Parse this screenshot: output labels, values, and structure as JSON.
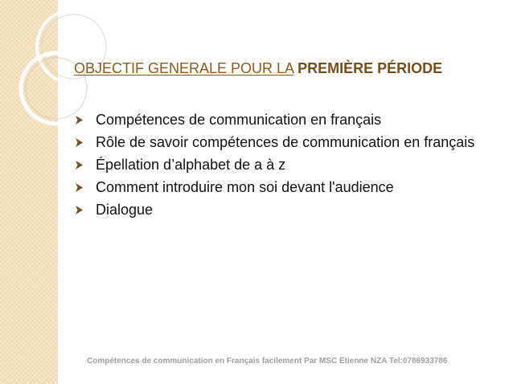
{
  "slide": {
    "title": {
      "underlined_part": "OBJECTIF GENERALE  POUR LA",
      "bold_part": "PREMIÈRE PÉRIODE"
    },
    "bullets": [
      "Compétences de communication en français",
      "Rôle de savoir  compétences de communication en français",
      "Épellation d’alphabet de a à z",
      "Comment introduire mon soi devant l'audience",
      "Dialogue"
    ],
    "footer": "Compétences de communication en  Français facilement  Par MSC Etienne NZA  Tel:0786933786"
  },
  "colors": {
    "title": "#8a5a1c",
    "bullet_arrow": "#7a4d18",
    "side_band": "#f7e7c8",
    "footer": "#9e9f9e"
  },
  "icons": {
    "bullet": "arrowhead-bullet-icon"
  }
}
